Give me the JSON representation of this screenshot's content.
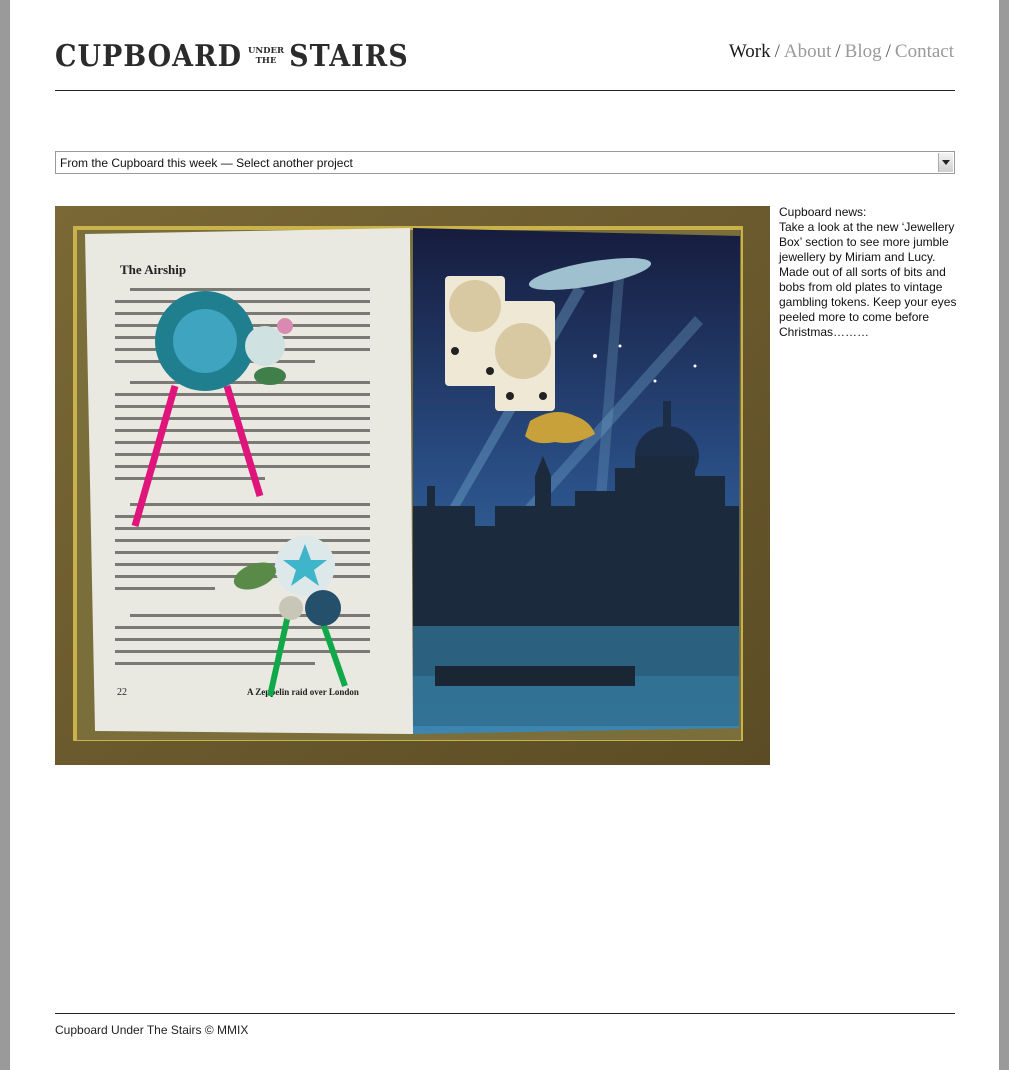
{
  "header": {
    "logo": {
      "left": "CUPBOARD",
      "small_top": "UNDER",
      "small_bottom": "THE",
      "right": "STAIRS"
    },
    "nav": [
      {
        "label": "Work",
        "active": true
      },
      {
        "label": "About",
        "active": false
      },
      {
        "label": "Blog",
        "active": false
      },
      {
        "label": "Contact",
        "active": false
      }
    ],
    "nav_separator": "/"
  },
  "project_select": {
    "selected": "From the Cupboard this week  —  Select another project"
  },
  "photo": {
    "book_page": {
      "heading": "The Airship",
      "page_number": "22",
      "caption": "A Zeppelin raid over London"
    }
  },
  "news": {
    "title": "Cupboard news:",
    "body": "Take a look at the new ‘Jewellery Box’ section to see more jumble jewellery by Miriam and Lucy. Made out of all sorts of bits and bobs from old plates to vintage gambling tokens. Keep your eyes peeled more to come before Christmas………"
  },
  "footer": {
    "text": "Cupboard Under The Stairs © MMIX"
  },
  "colors": {
    "page_bg": "#ffffff",
    "outer_bg": "#9a9a9a",
    "nav_active": "#1a1a1a",
    "nav_inactive": "#9a9a9a",
    "rule": "#222222"
  }
}
